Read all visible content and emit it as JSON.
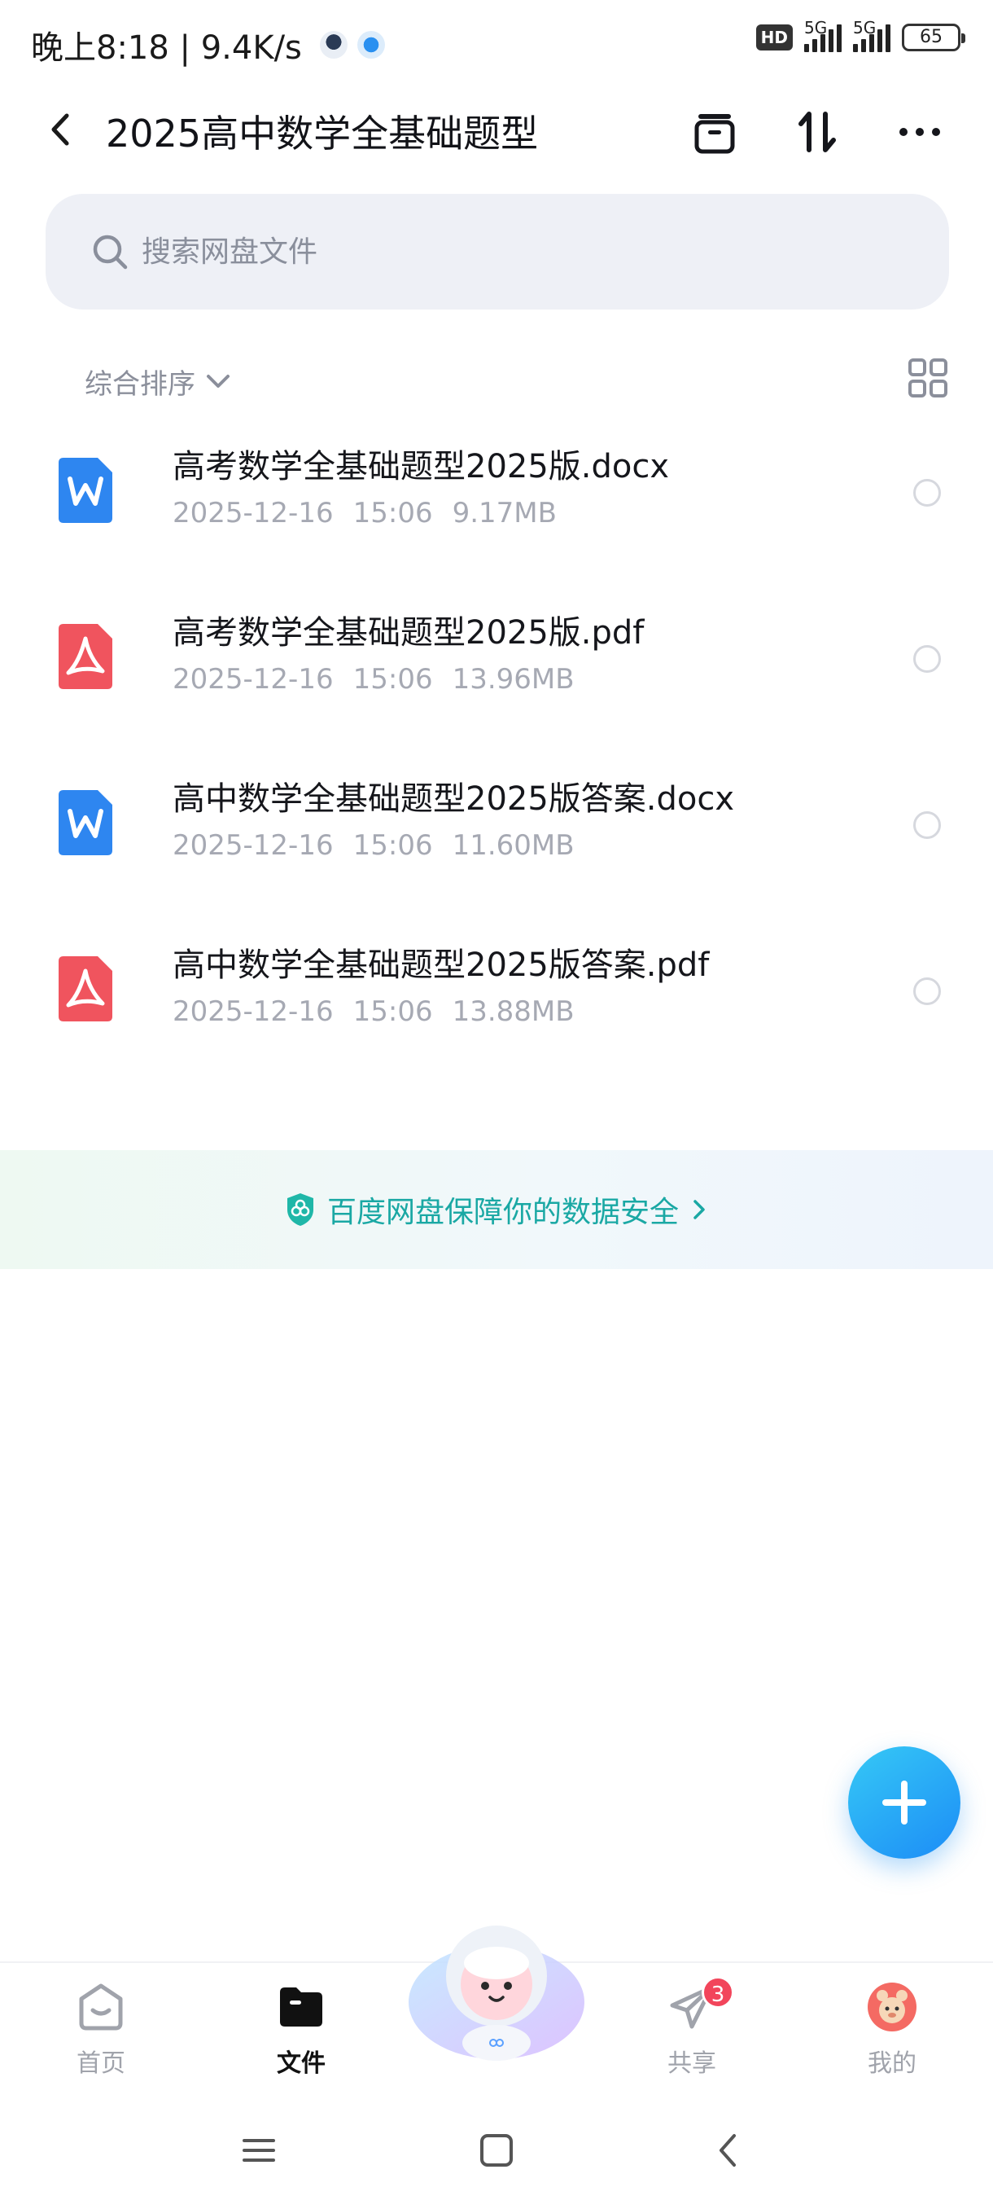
{
  "status_bar": {
    "time_speed": "晚上8:18 | 9.4K/s",
    "hd_label": "HD",
    "network_1": "5G",
    "network_2": "5G",
    "battery": "65"
  },
  "header": {
    "title": "2025高中数学全基础题型",
    "icons": [
      "back-icon",
      "archive-icon",
      "sort-icon",
      "more-icon"
    ]
  },
  "search": {
    "placeholder": "搜索网盘文件"
  },
  "sort": {
    "label": "综合排序"
  },
  "files": [
    {
      "name": "高考数学全基础题型2025版.docx",
      "date": "2025-12-16",
      "time": "15:06",
      "size": "9.17MB",
      "type": "word"
    },
    {
      "name": "高考数学全基础题型2025版.pdf",
      "date": "2025-12-16",
      "time": "15:06",
      "size": "13.96MB",
      "type": "pdf"
    },
    {
      "name": "高中数学全基础题型2025版答案.docx",
      "date": "2025-12-16",
      "time": "15:06",
      "size": "11.60MB",
      "type": "word"
    },
    {
      "name": "高中数学全基础题型2025版答案.pdf",
      "date": "2025-12-16",
      "time": "15:06",
      "size": "13.88MB",
      "type": "pdf"
    }
  ],
  "banner": {
    "text": "百度网盘保障你的数据安全"
  },
  "tabs": [
    {
      "label": "首页",
      "icon": "home-icon",
      "active": false
    },
    {
      "label": "文件",
      "icon": "folder-icon",
      "active": true
    },
    {
      "label": "共享",
      "icon": "paper-plane-icon",
      "active": false,
      "badge": "3"
    },
    {
      "label": "我的",
      "icon": "avatar-icon",
      "active": false
    }
  ],
  "colors": {
    "accent": "#1c8cf7",
    "word_blue": "#2e86f0",
    "pdf_red": "#f0545e",
    "secure_teal": "#1aa8a4",
    "badge_red": "#f2455b"
  }
}
